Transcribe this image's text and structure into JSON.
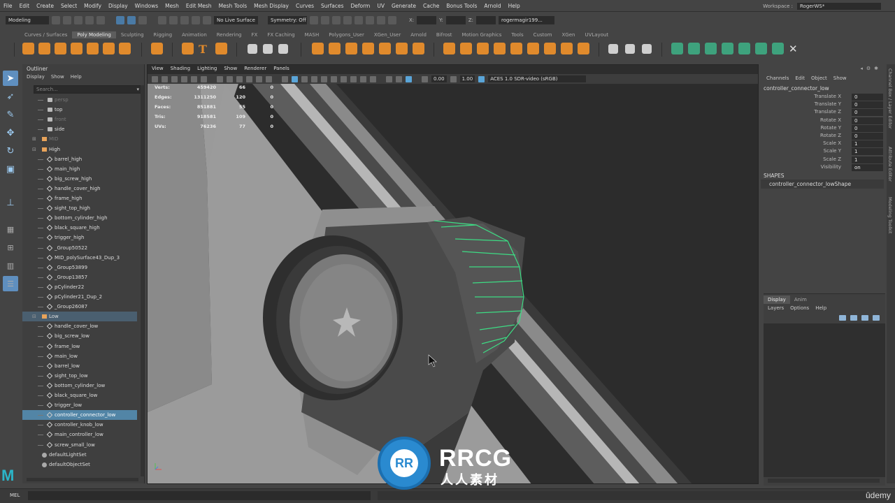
{
  "menubar": {
    "items": [
      "File",
      "Edit",
      "Create",
      "Select",
      "Modify",
      "Display",
      "Windows",
      "Mesh",
      "Edit Mesh",
      "Mesh Tools",
      "Mesh Display",
      "Curves",
      "Surfaces",
      "Deform",
      "UV",
      "Generate",
      "Cache",
      "Bonus Tools",
      "Arnold",
      "Help"
    ]
  },
  "workspace": {
    "label": "Workspace :",
    "value": "RogerWS*"
  },
  "status_line": {
    "mode": "Modeling",
    "live_surface": "No Live Surface",
    "symmetry": "Symmetry: Off",
    "x_label": "X:",
    "y_label": "Y:",
    "z_label": "Z:",
    "user": "rogermagir199..."
  },
  "shelf_tabs": [
    "Curves / Surfaces",
    "Poly Modeling",
    "Sculpting",
    "Rigging",
    "Animation",
    "Rendering",
    "FX",
    "FX Caching",
    "MASH",
    "Polygons_User",
    "XGen_User",
    "Arnold",
    "Bifrost",
    "Motion Graphics",
    "Tools",
    "Custom",
    "XGen",
    "UVLayout"
  ],
  "shelf_active": "Poly Modeling",
  "outliner": {
    "title": "Outliner",
    "menu": [
      "Display",
      "Show",
      "Help"
    ],
    "search_placeholder": "Search...",
    "items": [
      {
        "label": "persp",
        "icon": "camera-icon",
        "depth": 2,
        "dim": true
      },
      {
        "label": "top",
        "icon": "camera-icon",
        "depth": 2
      },
      {
        "label": "front",
        "icon": "camera-icon",
        "depth": 2,
        "dim": true
      },
      {
        "label": "side",
        "icon": "camera-icon",
        "depth": 2
      },
      {
        "label": "MID",
        "icon": "group-icon",
        "depth": 1,
        "dim": true,
        "expander": "+"
      },
      {
        "label": "High",
        "icon": "group-icon",
        "depth": 1,
        "expander": "-"
      },
      {
        "label": "barrel_high",
        "icon": "mesh-icon",
        "depth": 2
      },
      {
        "label": "main_high",
        "icon": "mesh-icon",
        "depth": 2
      },
      {
        "label": "big_screw_high",
        "icon": "mesh-icon",
        "depth": 2
      },
      {
        "label": "handle_cover_high",
        "icon": "mesh-icon",
        "depth": 2
      },
      {
        "label": "frame_high",
        "icon": "mesh-icon",
        "depth": 2
      },
      {
        "label": "sight_top_high",
        "icon": "mesh-icon",
        "depth": 2
      },
      {
        "label": "bottom_cylinder_high",
        "icon": "mesh-icon",
        "depth": 2
      },
      {
        "label": "black_square_high",
        "icon": "mesh-icon",
        "depth": 2
      },
      {
        "label": "trigger_high",
        "icon": "mesh-icon",
        "depth": 2
      },
      {
        "label": "_Group50522",
        "icon": "mesh-icon",
        "depth": 2
      },
      {
        "label": "MID_polySurface43_Dup_3",
        "icon": "mesh-icon",
        "depth": 2
      },
      {
        "label": "_Group53899",
        "icon": "mesh-icon",
        "depth": 2
      },
      {
        "label": "_Group13857",
        "icon": "mesh-icon",
        "depth": 2
      },
      {
        "label": "pCylinder22",
        "icon": "mesh-icon",
        "depth": 2
      },
      {
        "label": "pCylinder21_Dup_2",
        "icon": "mesh-icon",
        "depth": 2
      },
      {
        "label": "_Group26087",
        "icon": "mesh-icon",
        "depth": 2
      },
      {
        "label": "Low",
        "icon": "group-icon",
        "depth": 1,
        "expander": "-",
        "highlight": true
      },
      {
        "label": "handle_cover_low",
        "icon": "mesh-icon",
        "depth": 2
      },
      {
        "label": "big_screw_low",
        "icon": "mesh-icon",
        "depth": 2
      },
      {
        "label": "frame_low",
        "icon": "mesh-icon",
        "depth": 2
      },
      {
        "label": "main_low",
        "icon": "mesh-icon",
        "depth": 2
      },
      {
        "label": "barrel_low",
        "icon": "mesh-icon",
        "depth": 2
      },
      {
        "label": "sight_top_low",
        "icon": "mesh-icon",
        "depth": 2
      },
      {
        "label": "bottom_cylinder_low",
        "icon": "mesh-icon",
        "depth": 2
      },
      {
        "label": "black_square_low",
        "icon": "mesh-icon",
        "depth": 2
      },
      {
        "label": "trigger_low",
        "icon": "mesh-icon",
        "depth": 2
      },
      {
        "label": "controller_connector_low",
        "icon": "mesh-icon",
        "depth": 2,
        "selected": true
      },
      {
        "label": "controller_knob_low",
        "icon": "mesh-icon",
        "depth": 2
      },
      {
        "label": "main_controller_low",
        "icon": "mesh-icon",
        "depth": 2
      },
      {
        "label": "screw_small_low",
        "icon": "mesh-icon",
        "depth": 2
      },
      {
        "label": "defaultLightSet",
        "icon": "set-icon",
        "depth": 1
      },
      {
        "label": "defaultObjectSet",
        "icon": "set-icon",
        "depth": 1
      }
    ]
  },
  "viewport": {
    "menu": [
      "View",
      "Shading",
      "Lighting",
      "Show",
      "Renderer",
      "Panels"
    ],
    "exposure": "0.00",
    "gamma": "1.00",
    "color_space": "ACES 1.0 SDR-video (sRGB)",
    "hud": [
      {
        "label": "Verts:",
        "v1": "459420",
        "v2": "66",
        "v3": "0"
      },
      {
        "label": "Edges:",
        "v1": "1311250",
        "v2": "120",
        "v3": "0"
      },
      {
        "label": "Faces:",
        "v1": "851881",
        "v2": "55",
        "v3": "0"
      },
      {
        "label": "Tris:",
        "v1": "918581",
        "v2": "109",
        "v3": "0"
      },
      {
        "label": "UVs:",
        "v1": "76236",
        "v2": "77",
        "v3": "0"
      }
    ]
  },
  "channel_box": {
    "menu": [
      "Channels",
      "Edit",
      "Object",
      "Show"
    ],
    "object_name": "controller_connector_low",
    "attributes": [
      {
        "name": "Translate X",
        "value": "0"
      },
      {
        "name": "Translate Y",
        "value": "0"
      },
      {
        "name": "Translate Z",
        "value": "0"
      },
      {
        "name": "Rotate X",
        "value": "0"
      },
      {
        "name": "Rotate Y",
        "value": "0"
      },
      {
        "name": "Rotate Z",
        "value": "0"
      },
      {
        "name": "Scale X",
        "value": "1"
      },
      {
        "name": "Scale Y",
        "value": "1"
      },
      {
        "name": "Scale Z",
        "value": "1"
      },
      {
        "name": "Visibility",
        "value": "on"
      }
    ],
    "shapes_header": "SHAPES",
    "shape_name": "controller_connector_lowShape"
  },
  "side_tabs": [
    "Channel Box / Layer Editor",
    "Attribute Editor",
    "Modeling Toolkit"
  ],
  "layer_editor": {
    "tabs": [
      "Display",
      "Anim"
    ],
    "active_tab": "Display",
    "menu": [
      "Layers",
      "Options",
      "Help"
    ]
  },
  "command_line": {
    "label": "MEL"
  },
  "watermark": {
    "logo_text": "RR",
    "title": "RRCG",
    "subtitle": "人人素材"
  },
  "udemy": "ûdemy",
  "colors": {
    "selection": "#5285a6",
    "accent": "#5f8fbf",
    "wireframe": "#3ddc84",
    "shelf_orange": "#e08a2c",
    "shelf_teal": "#3ea27d"
  }
}
